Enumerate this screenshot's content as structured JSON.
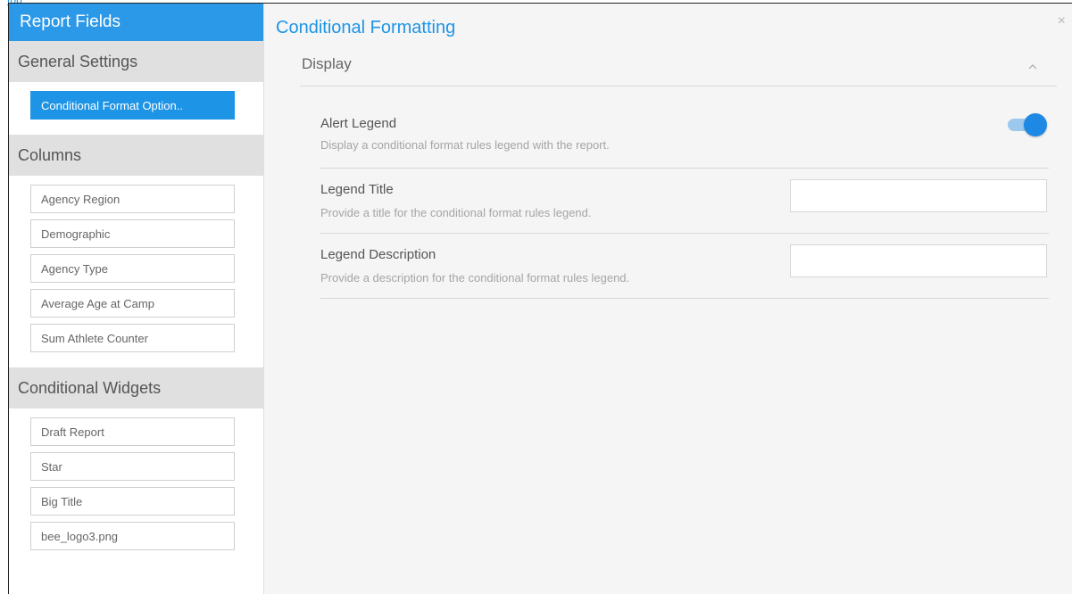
{
  "top_link": "top",
  "sidebar": {
    "title": "Report Fields",
    "sections": [
      {
        "title": "General Settings",
        "items": [
          "Conditional Format Option.."
        ]
      },
      {
        "title": "Columns",
        "items": [
          "Agency Region",
          "Demographic",
          "Agency Type",
          "Average Age at Camp",
          "Sum Athlete Counter"
        ]
      },
      {
        "title": "Conditional Widgets",
        "items": [
          "Draft Report",
          "Star",
          "Big Title",
          "bee_logo3.png"
        ]
      }
    ]
  },
  "main": {
    "title": "Conditional Formatting",
    "close_symbol": "×",
    "panel": {
      "title": "Display",
      "rows": [
        {
          "label": "Alert Legend",
          "description": "Display a conditional format rules legend with the report.",
          "toggle_on": true
        },
        {
          "label": "Legend Title",
          "description": "Provide a title for the conditional format rules legend.",
          "value": ""
        },
        {
          "label": "Legend Description",
          "description": "Provide a description for the conditional format rules legend.",
          "value": ""
        }
      ]
    }
  },
  "colors": {
    "accent": "#1e94e6",
    "header_blue": "#2c98e8",
    "section_gray": "#e0e0e0",
    "toggle_track": "#9dc8ee"
  },
  "icons": {
    "close": "close-icon",
    "collapse": "chevron-up-icon"
  }
}
